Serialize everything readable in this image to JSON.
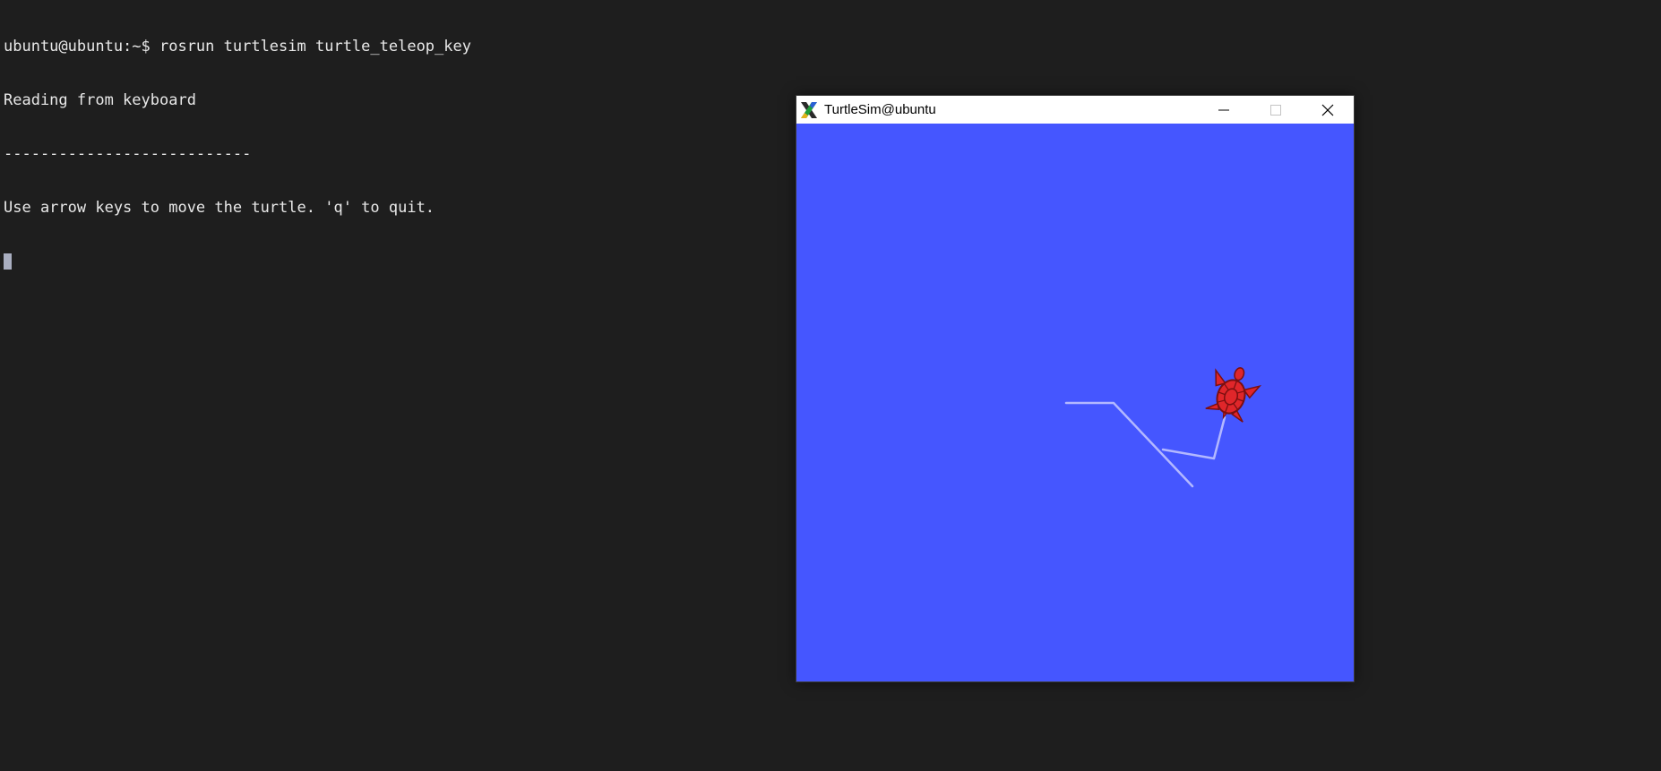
{
  "terminal": {
    "lines": [
      "ubuntu@ubuntu:~$ rosrun turtlesim turtle_teleop_key",
      "Reading from keyboard",
      "---------------------------",
      "Use arrow keys to move the turtle. 'q' to quit."
    ],
    "background_color": "#1e1e1e",
    "text_color": "#e8e8e8"
  },
  "turtlesim_window": {
    "title": "TurtleSim@ubuntu",
    "app_icon": "x11-icon",
    "controls": [
      "minimize-icon",
      "maximize-icon",
      "close-icon"
    ],
    "canvas_color": "#4556ff",
    "pen_color": "#b3b8ff",
    "turtle_icon": "turtle-icon",
    "turtle_color": "#e0262a"
  }
}
